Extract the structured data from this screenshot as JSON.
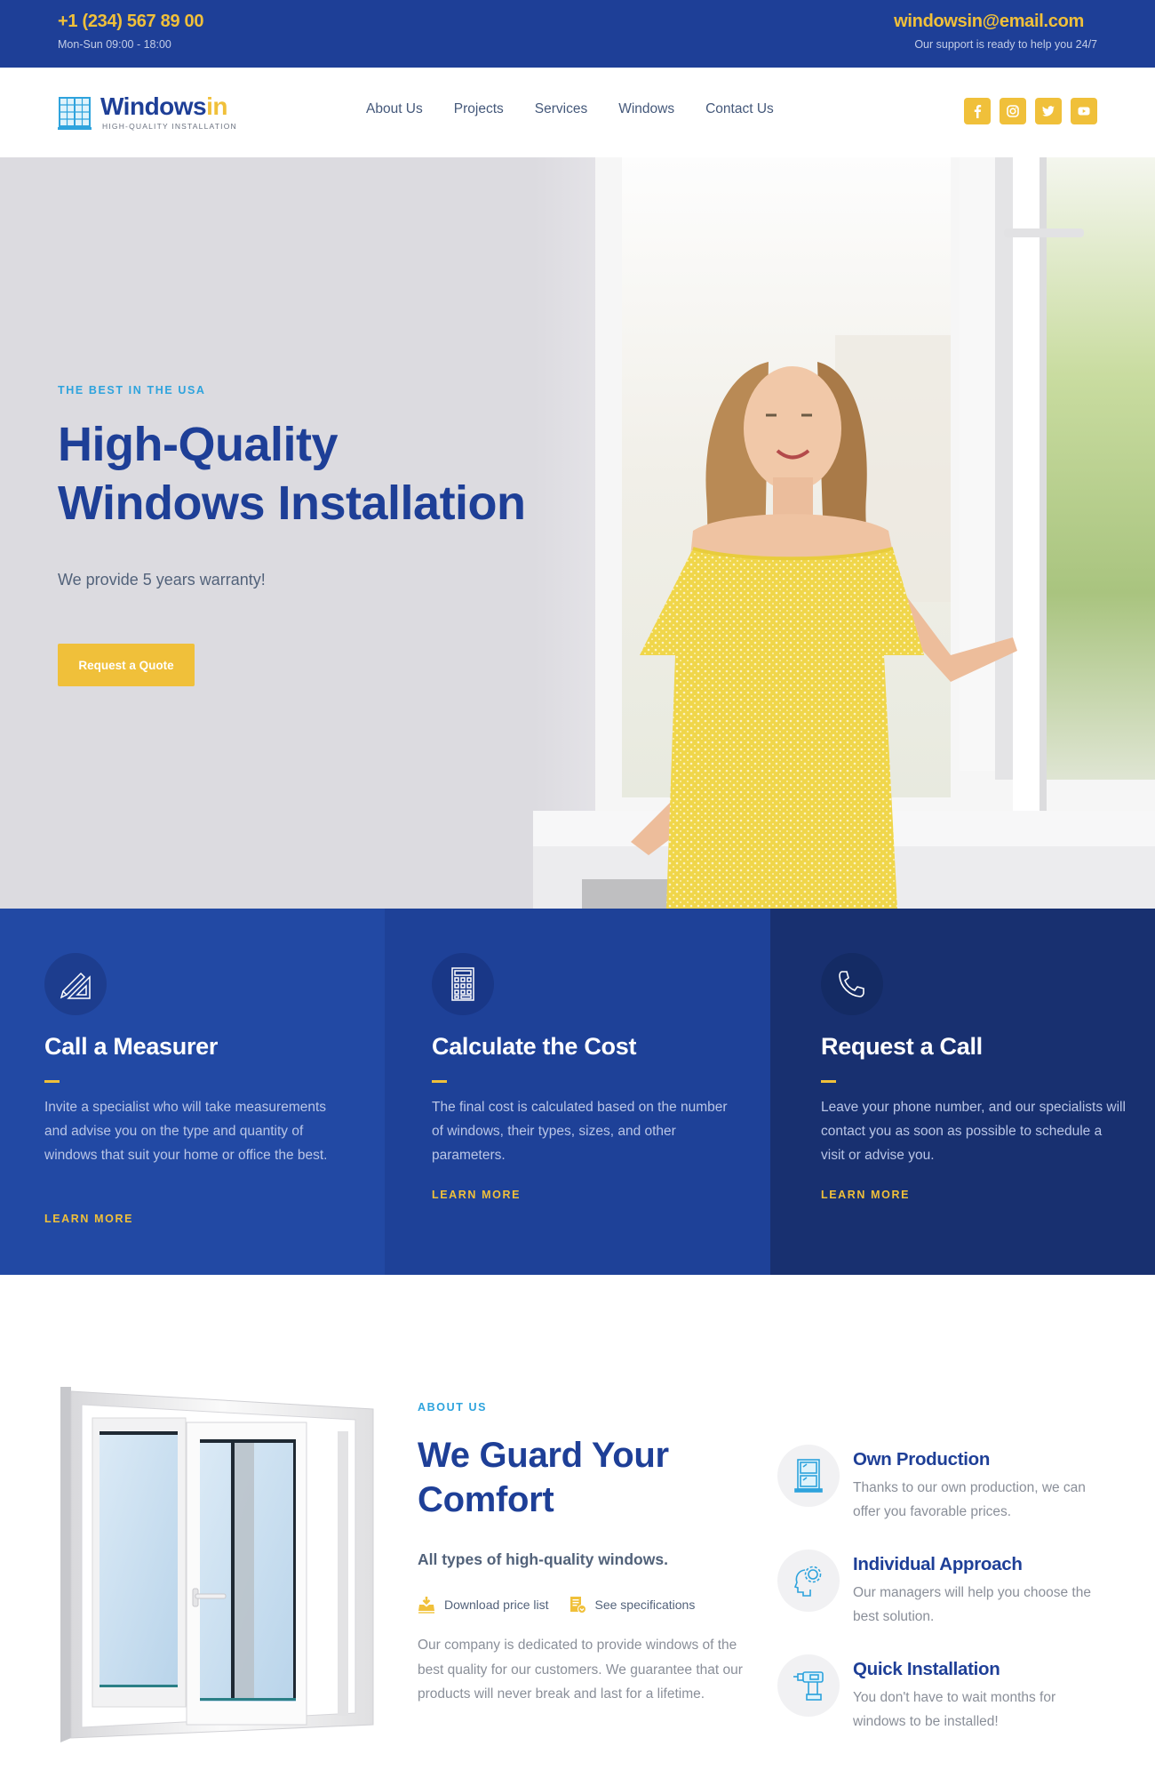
{
  "topbar": {
    "phone": "+1 (234) 567 89 00",
    "hours": "Mon-Sun 09:00 - 18:00",
    "email": "windowsin@email.com",
    "support": "Our support is ready to help you 24/7"
  },
  "brand": {
    "name_main": "Windows",
    "name_accent": "in",
    "tagline": "HIGH-QUALITY INSTALLATION",
    "icon": "window-logo-icon"
  },
  "nav": {
    "items": [
      {
        "label": "About Us"
      },
      {
        "label": "Projects"
      },
      {
        "label": "Services"
      },
      {
        "label": "Windows"
      },
      {
        "label": "Contact Us"
      }
    ],
    "socials": [
      {
        "name": "facebook",
        "icon": "facebook-icon"
      },
      {
        "name": "instagram",
        "icon": "instagram-icon"
      },
      {
        "name": "twitter",
        "icon": "twitter-icon"
      },
      {
        "name": "youtube",
        "icon": "youtube-icon"
      }
    ]
  },
  "hero": {
    "kicker": "THE BEST IN THE USA",
    "title_line1": "High-Quality",
    "title_line2": "Windows Installation",
    "subtitle": "We provide 5 years warranty!",
    "cta_label": "Request a Quote",
    "image_alt": "Smiling woman in a yellow dress opening a white PVC window"
  },
  "features": [
    {
      "icon": "ruler-pencil-icon",
      "title": "Call a Measurer",
      "description": "Invite a specialist who will take measurements and advise you on the type and quantity of windows that suit your home or office the best.",
      "link": "LEARN MORE"
    },
    {
      "icon": "calculator-icon",
      "title": "Calculate the Cost",
      "description": "The final cost is calculated based on the number of windows, their types, sizes, and other parameters.",
      "link": "LEARN MORE"
    },
    {
      "icon": "phone-icon",
      "title": "Request a Call",
      "description": "Leave your phone number, and our specialists will contact you as soon as possible to schedule a visit or advise you.",
      "link": "LEARN MORE"
    }
  ],
  "about": {
    "kicker": "ABOUT US",
    "title_line1": "We Guard Your",
    "title_line2": "Comfort",
    "subtitle": "All types of high-quality windows.",
    "links": [
      {
        "label": "Download price list",
        "icon": "download-icon"
      },
      {
        "label": "See specifications",
        "icon": "document-check-icon"
      }
    ],
    "text": "Our company is dedicated to provide windows of the best quality for our customers. We guarantee that our products will never break and last for a lifetime.",
    "image_alt": "White sliding PVC window"
  },
  "benefits": [
    {
      "icon": "window-icon",
      "title": "Own Production",
      "description": "Thanks to our own production, we can offer you favorable prices."
    },
    {
      "icon": "head-gear-icon",
      "title": "Individual Approach",
      "description": "Our managers will help you choose the best solution."
    },
    {
      "icon": "drill-icon",
      "title": "Quick Installation",
      "description": "You don't have to wait months for windows to be installed!"
    }
  ],
  "colors": {
    "primary_blue": "#1e3f97",
    "accent_yellow": "#f0c03a",
    "kicker_cyan": "#2ea3dd",
    "feature_1_bg": "#2249a4",
    "feature_2_bg": "#1e4198",
    "feature_3_bg": "#183070"
  }
}
